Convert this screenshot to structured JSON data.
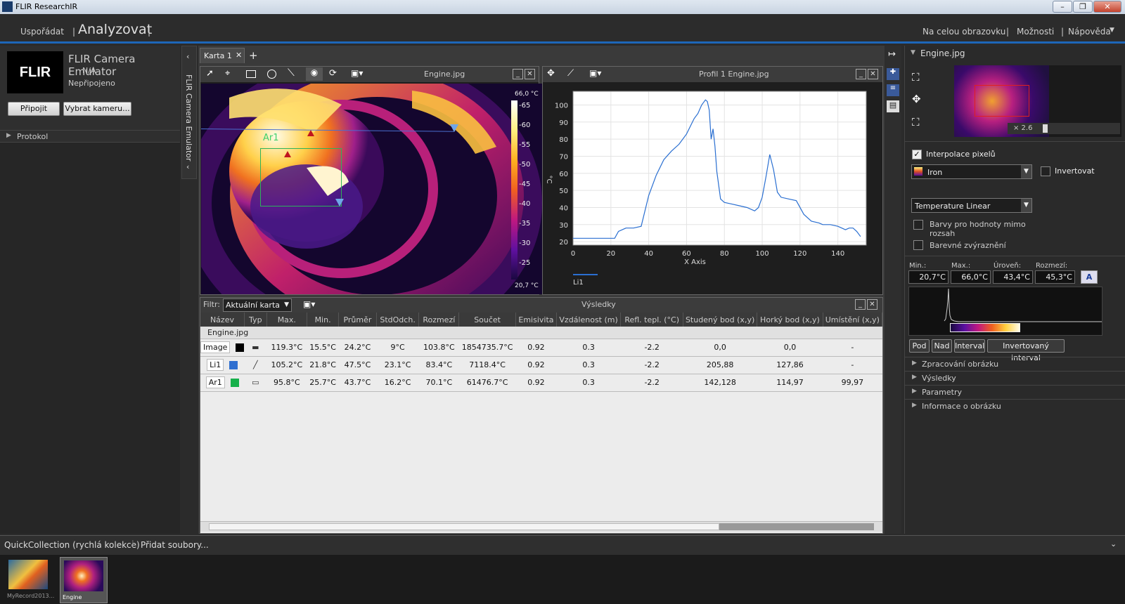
{
  "app": {
    "title": "FLIR ResearchIR"
  },
  "menu": {
    "arrange": "Uspořádat",
    "analyze": "Analyzovat",
    "fullscreen": "Na celou obrazovku",
    "options": "Možnosti",
    "help": "Nápověda"
  },
  "camera": {
    "name": "FLIR Camera Emulator",
    "model": "N/A",
    "status": "Nepřipojeno",
    "connect": "Připojit",
    "select": "Vybrat kameru...",
    "protocol": "Protokol",
    "logo": "FLIR",
    "side_tab": "FLIR Camera Emulator"
  },
  "tabs": {
    "tab1": "Karta 1",
    "add": "+"
  },
  "image_panel": {
    "title": "Engine.jpg",
    "area_label": "Ar1",
    "scale_max": "66,0 °C",
    "scale_min": "20,7 °C",
    "scale_ticks": [
      "65",
      "60",
      "55",
      "50",
      "45",
      "40",
      "35",
      "30",
      "25"
    ]
  },
  "profile_panel": {
    "title": "Profil 1 Engine.jpg",
    "legend": "Li1"
  },
  "chart_data": {
    "type": "line",
    "title": "",
    "xlabel": "X Axis",
    "ylabel": "°C",
    "xlim": [
      0,
      155
    ],
    "ylim": [
      18,
      108
    ],
    "xticks": [
      0,
      20,
      40,
      60,
      80,
      100,
      120,
      140
    ],
    "yticks": [
      20,
      30,
      40,
      50,
      60,
      70,
      80,
      90,
      100
    ],
    "series": [
      {
        "name": "Li1",
        "color": "#2a6fd1",
        "x": [
          0,
          10,
          20,
          22,
          24,
          28,
          32,
          36,
          40,
          44,
          48,
          52,
          56,
          60,
          64,
          66,
          68,
          70,
          71,
          72,
          73,
          74,
          75,
          76,
          78,
          80,
          84,
          88,
          92,
          96,
          98,
          100,
          102,
          104,
          106,
          108,
          110,
          114,
          118,
          122,
          126,
          130,
          132,
          136,
          140,
          144,
          146,
          148,
          150,
          152
        ],
        "y": [
          22,
          22,
          22,
          22,
          26,
          28,
          28,
          29,
          47,
          59,
          68,
          73,
          77,
          83,
          92,
          95,
          100,
          103,
          102,
          97,
          80,
          86,
          76,
          61,
          45,
          43,
          42,
          41,
          40,
          38,
          40,
          46,
          58,
          71,
          62,
          49,
          46,
          45,
          44,
          36,
          32,
          31,
          30,
          30,
          29,
          27,
          28,
          28,
          26,
          23
        ]
      }
    ]
  },
  "results": {
    "title": "Výsledky",
    "filter_label": "Filtr:",
    "filter_value": "Aktuální karta",
    "group": "Engine.jpg",
    "columns": [
      "Název",
      "Typ",
      "Max.",
      "Min.",
      "Průměr",
      "StdOdch.",
      "Rozmezí",
      "Součet",
      "Emisivita",
      "Vzdálenost (m)",
      "Refl. tepl. (°C)",
      "Studený bod (x,y)",
      "Horký bod (x,y)",
      "Umístění (x,y)"
    ],
    "rows": [
      {
        "name": "Image",
        "color": "#000000",
        "max": "119.3°C",
        "min": "15.5°C",
        "avg": "24.2°C",
        "std": "9°C",
        "range": "103.8°C",
        "sum": "1854735.7°C",
        "emis": "0.92",
        "dist": "0.3",
        "refl": "-2.2",
        "cold": "0,0",
        "hot": "0,0",
        "loc": "-"
      },
      {
        "name": "Li1",
        "color": "#2f6fd0",
        "max": "105.2°C",
        "min": "21.8°C",
        "avg": "47.5°C",
        "std": "23.1°C",
        "range": "83.4°C",
        "sum": "7118.4°C",
        "emis": "0.92",
        "dist": "0.3",
        "refl": "-2.2",
        "cold": "205,88",
        "hot": "127,86",
        "loc": "-"
      },
      {
        "name": "Ar1",
        "color": "#17b04b",
        "max": "95.8°C",
        "min": "25.7°C",
        "avg": "43.7°C",
        "std": "16.2°C",
        "range": "70.1°C",
        "sum": "61476.7°C",
        "emis": "0.92",
        "dist": "0.3",
        "refl": "-2.2",
        "cold": "142,128",
        "hot": "114,97",
        "loc": "99,97"
      }
    ]
  },
  "right": {
    "file": "Engine.jpg",
    "zoom": "× 2.6",
    "interp": "Interpolace pixelů",
    "palette": "Iron",
    "invert": "Invertovat",
    "scale_mode": "Temperature Linear",
    "oor": "Barvy pro hodnoty mimo rozsah",
    "highlight": "Barevné zvýraznění",
    "min_label": "Min.:",
    "max_label": "Max.:",
    "level_label": "Úroveň:",
    "span_label": "Rozmezí:",
    "min": "20,7°C",
    "max": "66,0°C",
    "level": "43,4°C",
    "span": "45,3°C",
    "btn_under": "Pod",
    "btn_over": "Nad",
    "btn_interval": "Interval",
    "btn_inv_interval": "Invertovaný interval",
    "sections": [
      "Zpracování obrázku",
      "Výsledky",
      "Parametry",
      "Informace o obrázku"
    ]
  },
  "bottom": {
    "quick": "QuickCollection (rychlá kolekce)",
    "add": "Přidat soubory...",
    "thumbs": [
      "MyRecord2013...",
      "Engine"
    ]
  }
}
